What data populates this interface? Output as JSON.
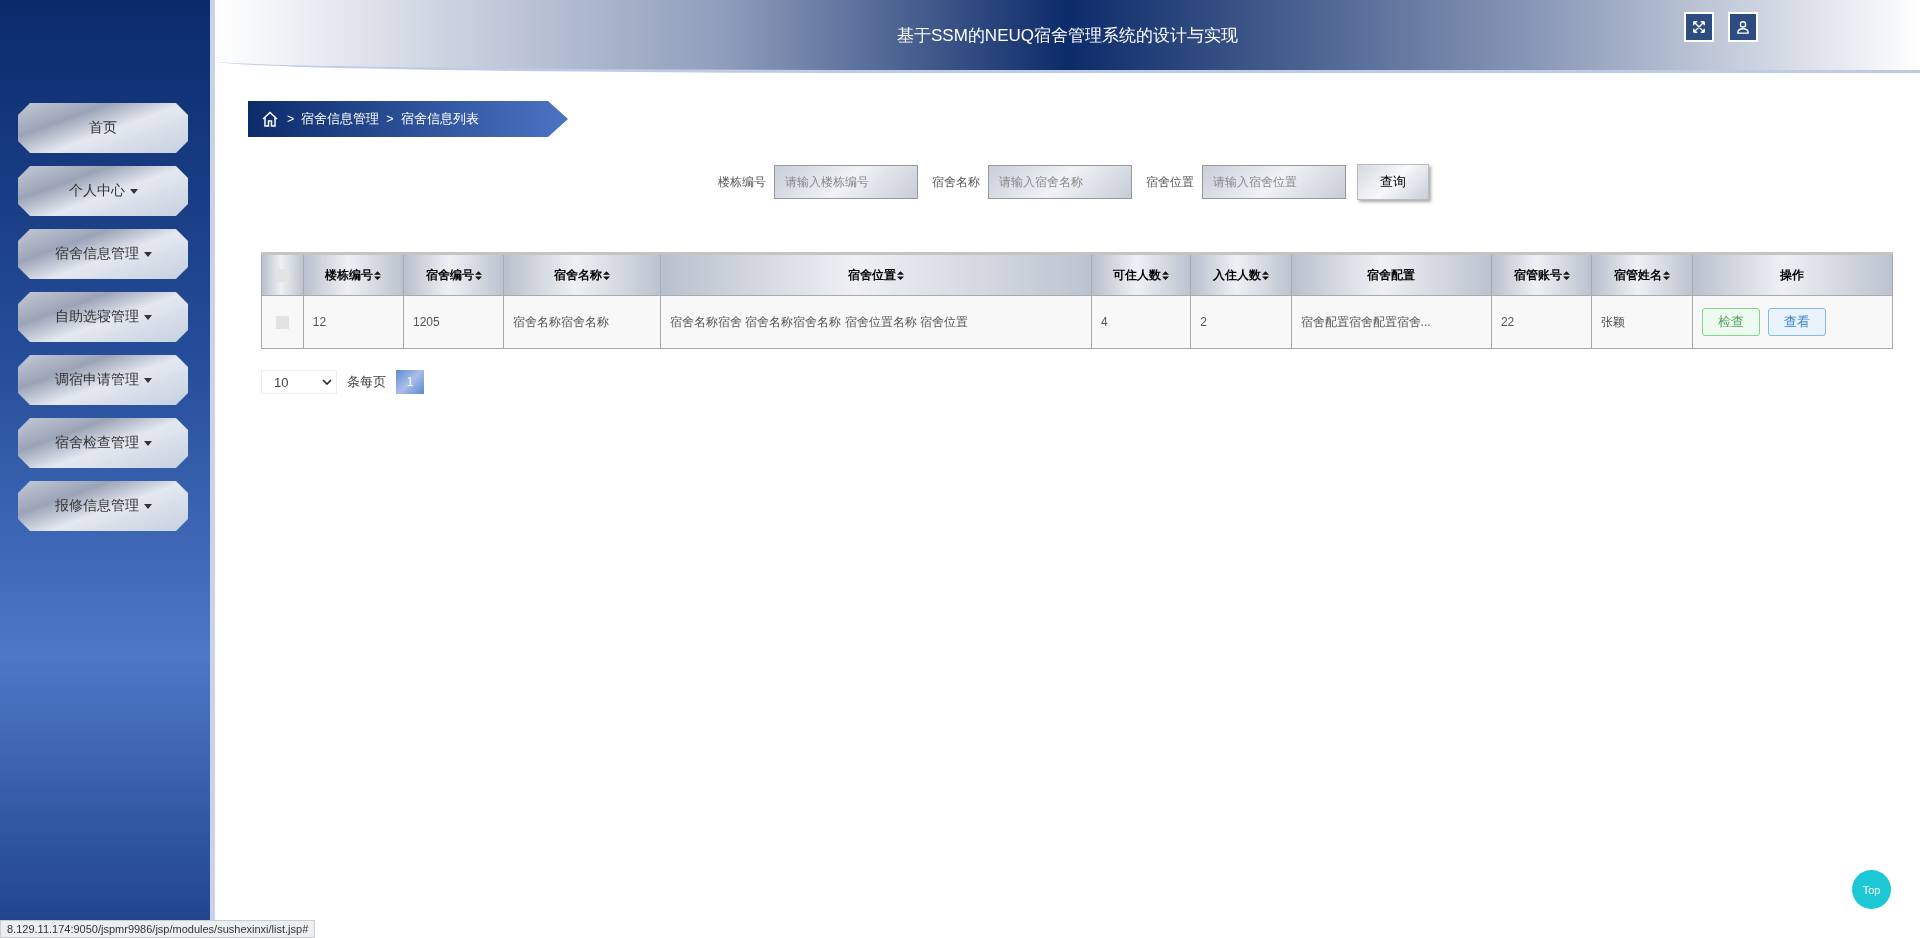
{
  "header": {
    "title": "基于SSM的NEUQ宿舍管理系统的设计与实现"
  },
  "sidebar": {
    "items": [
      {
        "label": "首页",
        "expandable": false
      },
      {
        "label": "个人中心",
        "expandable": true
      },
      {
        "label": "宿舍信息管理",
        "expandable": true
      },
      {
        "label": "自助选寝管理",
        "expandable": true
      },
      {
        "label": "调宿申请管理",
        "expandable": true
      },
      {
        "label": "宿舍检查管理",
        "expandable": true
      },
      {
        "label": "报修信息管理",
        "expandable": true
      }
    ]
  },
  "breadcrumb": [
    {
      "separator": ">",
      "label": "宿舍信息管理"
    },
    {
      "separator": ">",
      "label": "宿舍信息列表"
    }
  ],
  "search": {
    "fields": [
      {
        "label": "楼栋编号",
        "placeholder": "请输入楼栋编号"
      },
      {
        "label": "宿舍名称",
        "placeholder": "请输入宿舍名称"
      },
      {
        "label": "宿舍位置",
        "placeholder": "请输入宿舍位置"
      }
    ],
    "button": "查询"
  },
  "table": {
    "select_all_checked": false,
    "columns": [
      {
        "label": "楼栋编号",
        "sortable": true
      },
      {
        "label": "宿舍编号",
        "sortable": true
      },
      {
        "label": "宿舍名称",
        "sortable": true
      },
      {
        "label": "宿舍位置",
        "sortable": true
      },
      {
        "label": "可住人数",
        "sortable": true
      },
      {
        "label": "入住人数",
        "sortable": true
      },
      {
        "label": "宿舍配置",
        "sortable": false
      },
      {
        "label": "宿管账号",
        "sortable": true
      },
      {
        "label": "宿管姓名",
        "sortable": true
      },
      {
        "label": "操作",
        "sortable": false
      }
    ],
    "rows": [
      {
        "checked": false,
        "cells": [
          "12",
          "1205",
          "宿舍名称宿舍名称",
          "宿舍名称宿舍 宿舍名称宿舍名称 宿舍位置名称 宿舍位置",
          "4",
          "2",
          "宿舍配置宿舍配置宿舍...",
          "22",
          "张颖"
        ],
        "actions": [
          {
            "label": "检查",
            "kind": "check"
          },
          {
            "label": "查看",
            "kind": "view"
          }
        ]
      }
    ]
  },
  "pagination": {
    "page_size": "10",
    "page_size_label": "条每页",
    "pages": [
      {
        "label": "1",
        "selected": true
      }
    ]
  },
  "back_to_top": "Top",
  "status_bar": "8.129.11.174:9050/jspmr9986/jsp/modules/sushexinxi/list.jsp#"
}
